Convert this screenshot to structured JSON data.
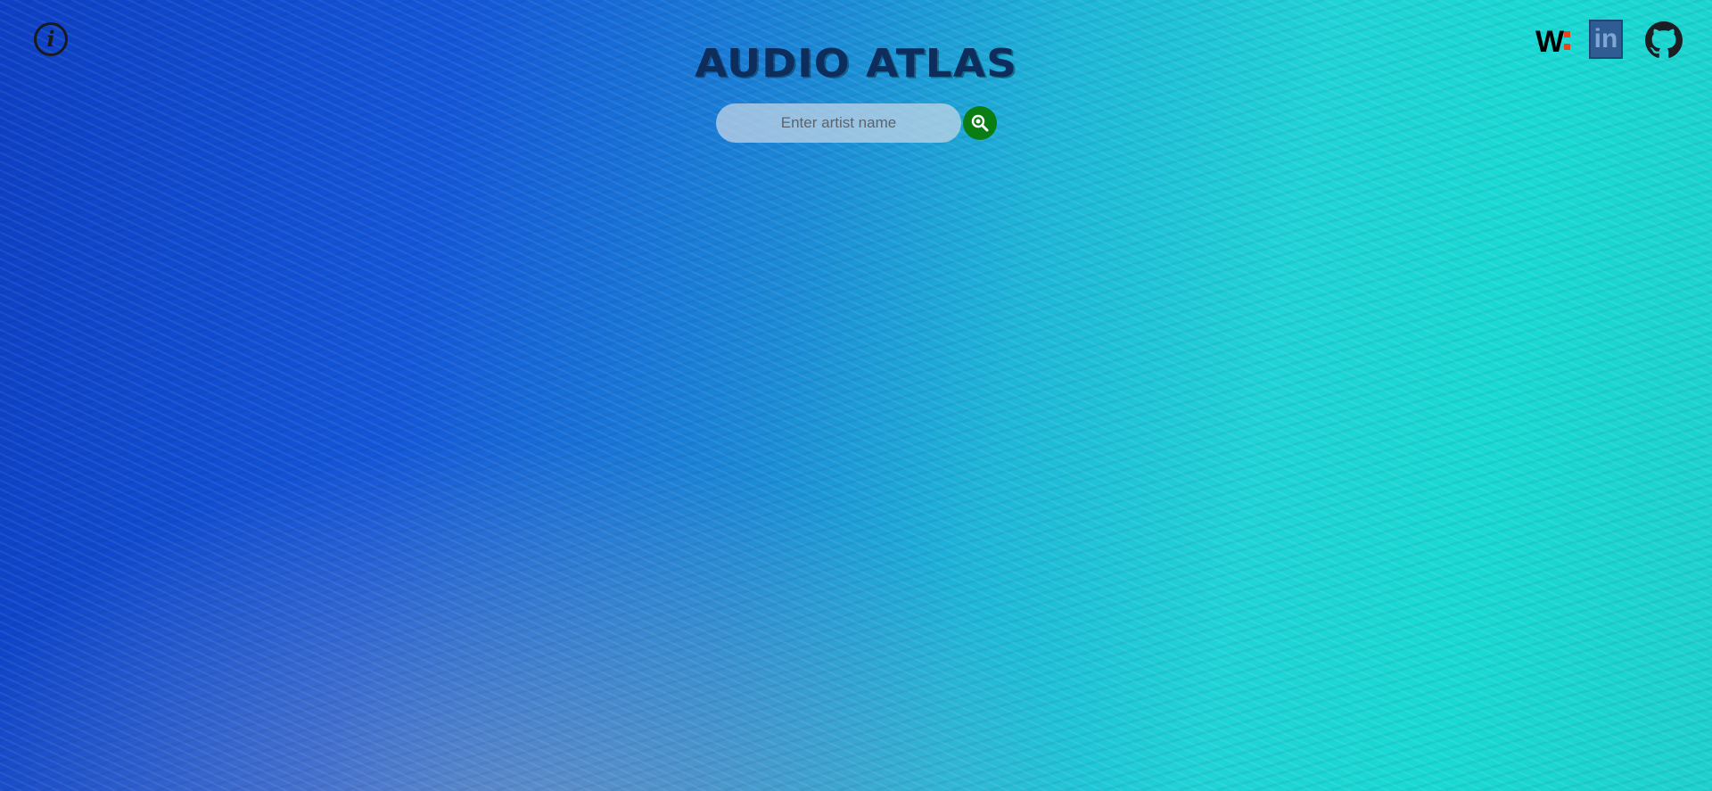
{
  "header": {
    "title": "AUDIO ATLAS",
    "info_glyph": "i"
  },
  "search": {
    "placeholder": "Enter artist name",
    "value": "",
    "button_icon": "search-icon"
  },
  "social": {
    "wmark_letter": "W",
    "wmark_icon": "w-logo-icon",
    "linkedin_text": "in",
    "linkedin_icon": "linkedin-icon",
    "github_icon": "github-icon"
  },
  "colors": {
    "title": "#0d2e5c",
    "search_button": "#0a7d14",
    "linkedin": "#2f5c92",
    "w_accent": "#e8431c"
  }
}
